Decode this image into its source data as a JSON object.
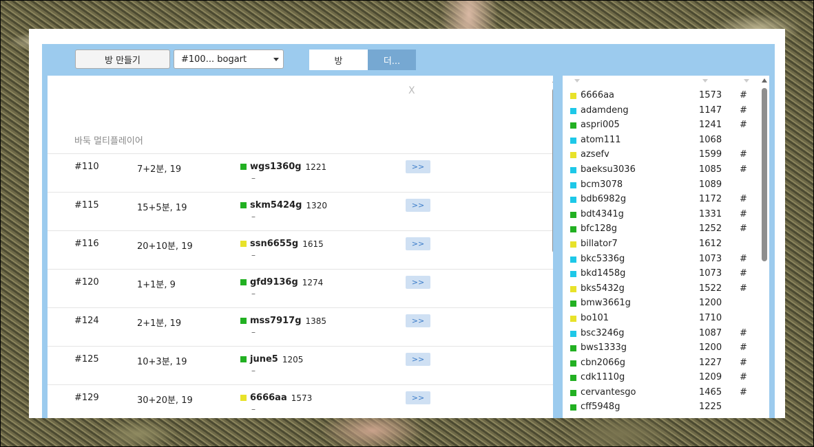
{
  "toolbar": {
    "create_room_label": "방 만들기",
    "room_select_value": "#100... bogart",
    "tab_room_label": "방",
    "tab_more_label": "더..."
  },
  "lobby": {
    "close_label": "X",
    "game_title": "바둑 멀티플레이어",
    "games": [
      {
        "id": "#110",
        "time_control": "7+2분, 19",
        "player": "wgs1360g",
        "rating": "1221",
        "color": "#22b022",
        "second": "–",
        "join_label": ">>"
      },
      {
        "id": "#115",
        "time_control": "15+5분, 19",
        "player": "skm5424g",
        "rating": "1320",
        "color": "#22b022",
        "second": "–",
        "join_label": ">>"
      },
      {
        "id": "#116",
        "time_control": "20+10분, 19",
        "player": "ssn6655g",
        "rating": "1615",
        "color": "#e8e22a",
        "second": "–",
        "join_label": ">>"
      },
      {
        "id": "#120",
        "time_control": "1+1분, 9",
        "player": "gfd9136g",
        "rating": "1274",
        "color": "#22b022",
        "second": "–",
        "join_label": ">>"
      },
      {
        "id": "#124",
        "time_control": "2+1분, 19",
        "player": "mss7917g",
        "rating": "1385",
        "color": "#22b022",
        "second": "–",
        "join_label": ">>"
      },
      {
        "id": "#125",
        "time_control": "10+3분, 19",
        "player": "june5",
        "rating": "1205",
        "color": "#22b022",
        "second": "–",
        "join_label": ">>"
      },
      {
        "id": "#129",
        "time_control": "30+20분, 19",
        "player": "6666aa",
        "rating": "1573",
        "color": "#e8e22a",
        "second": "–",
        "join_label": ">>"
      }
    ]
  },
  "users": [
    {
      "name": "6666aa",
      "rating": "1573",
      "mark": "#",
      "color": "#e8e22a"
    },
    {
      "name": "adamdeng",
      "rating": "1147",
      "mark": "#",
      "color": "#1ec8e8"
    },
    {
      "name": "aspri005",
      "rating": "1241",
      "mark": "#",
      "color": "#22b022"
    },
    {
      "name": "atom111",
      "rating": "1068",
      "mark": "",
      "color": "#1ec8e8"
    },
    {
      "name": "azsefv",
      "rating": "1599",
      "mark": "#",
      "color": "#e8e22a"
    },
    {
      "name": "baeksu3036",
      "rating": "1085",
      "mark": "#",
      "color": "#1ec8e8"
    },
    {
      "name": "bcm3078",
      "rating": "1089",
      "mark": "",
      "color": "#1ec8e8"
    },
    {
      "name": "bdb6982g",
      "rating": "1172",
      "mark": "#",
      "color": "#1ec8e8"
    },
    {
      "name": "bdt4341g",
      "rating": "1331",
      "mark": "#",
      "color": "#22b022"
    },
    {
      "name": "bfc128g",
      "rating": "1252",
      "mark": "#",
      "color": "#22b022"
    },
    {
      "name": "billator7",
      "rating": "1612",
      "mark": "",
      "color": "#e8e22a"
    },
    {
      "name": "bkc5336g",
      "rating": "1073",
      "mark": "#",
      "color": "#1ec8e8"
    },
    {
      "name": "bkd1458g",
      "rating": "1073",
      "mark": "#",
      "color": "#1ec8e8"
    },
    {
      "name": "bks5432g",
      "rating": "1522",
      "mark": "#",
      "color": "#e8e22a"
    },
    {
      "name": "bmw3661g",
      "rating": "1200",
      "mark": "",
      "color": "#22b022"
    },
    {
      "name": "bo101",
      "rating": "1710",
      "mark": "",
      "color": "#e8e22a"
    },
    {
      "name": "bsc3246g",
      "rating": "1087",
      "mark": "#",
      "color": "#1ec8e8"
    },
    {
      "name": "bws1333g",
      "rating": "1200",
      "mark": "#",
      "color": "#22b022"
    },
    {
      "name": "cbn2066g",
      "rating": "1227",
      "mark": "#",
      "color": "#22b022"
    },
    {
      "name": "cdk1110g",
      "rating": "1209",
      "mark": "#",
      "color": "#22b022"
    },
    {
      "name": "cervantesgo",
      "rating": "1465",
      "mark": "#",
      "color": "#22b022"
    },
    {
      "name": "cff5948g",
      "rating": "1225",
      "mark": "",
      "color": "#22b022"
    }
  ]
}
